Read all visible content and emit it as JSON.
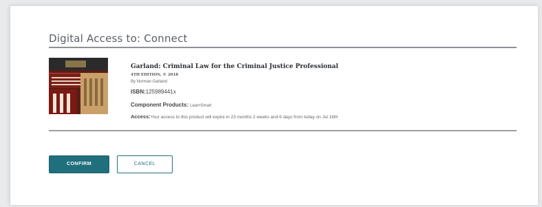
{
  "dialog": {
    "heading": "Digital Access to: Connect"
  },
  "product": {
    "title": "Garland: Criminal Law for the Criminal Justice Professional",
    "edition": "4TH EDITION, © 2018",
    "author": "By Norman Garland",
    "isbn_label": "ISBN:",
    "isbn_value": "125989441x",
    "component_label": "Component Products:",
    "component_value": "LearnSmart",
    "access_label": "Access:",
    "access_text": "Your access to this product will expire in 23 months 2 weeks and 6 days from today on Jul 16th"
  },
  "actions": {
    "confirm_label": "CONFIRM",
    "cancel_label": "CANCEL"
  },
  "colors": {
    "accent": "#1f6f7c"
  },
  "icons": {
    "cover": "book-cover-image"
  }
}
